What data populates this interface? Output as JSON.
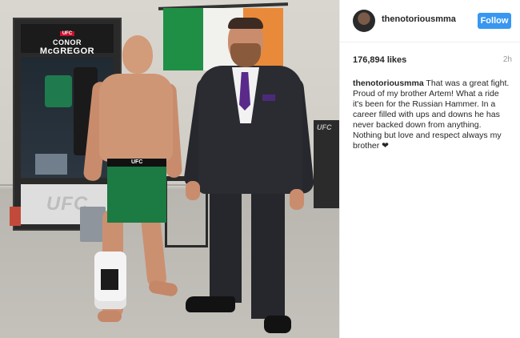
{
  "photo": {
    "locker_sign": {
      "logo": "UFC",
      "first_name": "CONOR",
      "last_name": "McGREGOR"
    },
    "locker_base_logo": "UFC",
    "shorts_brand": "UFC",
    "chair_logo": "UFC"
  },
  "header": {
    "username": "thenotoriousmma",
    "follow_label": "Follow"
  },
  "post": {
    "likes": "176,894 likes",
    "time": "2h",
    "caption_user": "thenotoriousmma",
    "caption_text": "That was a great fight. Proud of my brother Artem! What a ride it's been for the Russian Hammer. In a career filled with ups and downs he has never backed down from anything. Nothing but love and respect always my brother ❤"
  },
  "colors": {
    "follow_button": "#3897f0",
    "flag_green": "#1f8f45",
    "flag_white": "#f1f1ee",
    "flag_orange": "#e98a3a",
    "tie": "#5a2a8a"
  },
  "icons": {
    "heart": "heart-icon"
  }
}
